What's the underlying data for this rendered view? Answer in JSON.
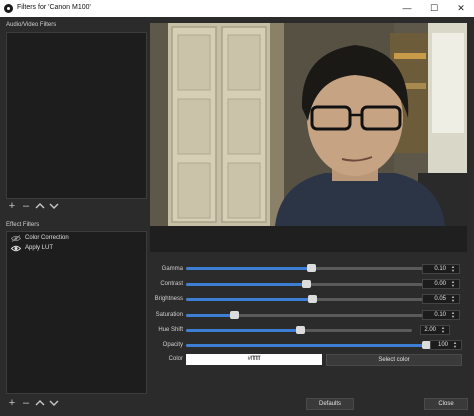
{
  "window": {
    "title": "Filters for 'Canon M100'"
  },
  "audio_video": {
    "label": "Audio/Video Filters"
  },
  "effect": {
    "label": "Effect Filters",
    "items": [
      {
        "label": "Color Correction"
      },
      {
        "label": "Apply LUT"
      }
    ]
  },
  "properties": {
    "rows": [
      {
        "label": "Gamma",
        "value": "0.10",
        "fraction": 0.52
      },
      {
        "label": "Contrast",
        "value": "0.00",
        "fraction": 0.5
      },
      {
        "label": "Brightness",
        "value": "0.05",
        "fraction": 0.525
      },
      {
        "label": "Saturation",
        "value": "0.10",
        "fraction": 0.2
      },
      {
        "label": "Hue Shift",
        "value": "2.00",
        "fraction": 0.505
      },
      {
        "label": "Opacity",
        "value": "100",
        "fraction": 1.0
      }
    ],
    "color_label": "Color",
    "color_value": "#ffffff",
    "select_color_label": "Select color"
  },
  "buttons": {
    "defaults": "Defaults",
    "close": "Close"
  },
  "colors": {
    "accent": "#3d7fd4",
    "background": "#2b2b2b",
    "list_bg": "#1d1d1d"
  }
}
